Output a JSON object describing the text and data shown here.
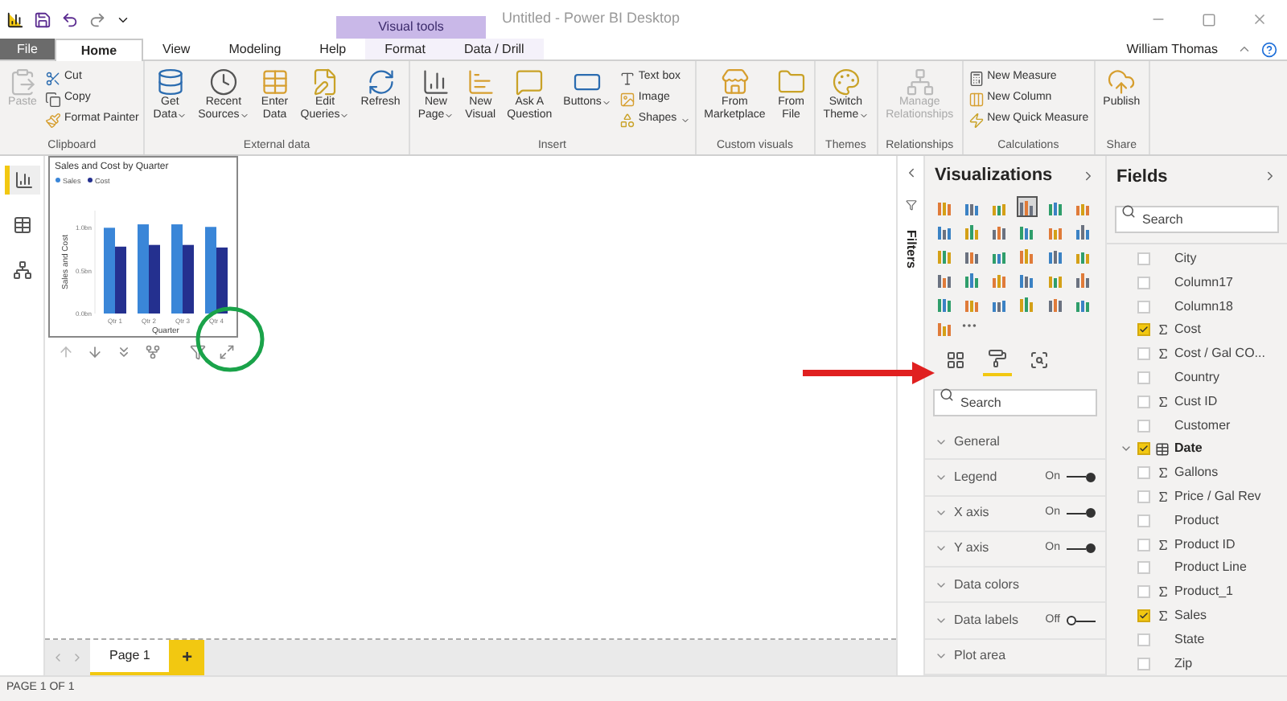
{
  "window": {
    "title": "Untitled - Power BI Desktop",
    "contextual_group": "Visual tools"
  },
  "tabs": [
    {
      "label": "File",
      "kind": "file",
      "selected": false
    },
    {
      "label": "Home",
      "kind": "normal",
      "selected": true
    },
    {
      "label": "View",
      "kind": "normal",
      "selected": false
    },
    {
      "label": "Modeling",
      "kind": "normal",
      "selected": false
    },
    {
      "label": "Help",
      "kind": "normal",
      "selected": false
    },
    {
      "label": "Format",
      "kind": "contextual",
      "selected": false
    },
    {
      "label": "Data / Drill",
      "kind": "contextual",
      "selected": false
    }
  ],
  "user": "William Thomas",
  "ribbon": [
    {
      "label": "Clipboard",
      "items": [
        {
          "kind": "large",
          "lines": [
            "Paste"
          ],
          "disabled": true,
          "dropdown": false
        },
        {
          "kind": "small",
          "lines": [
            "Cut"
          ],
          "disabled": false,
          "dropdown": false
        },
        {
          "kind": "small",
          "lines": [
            "Copy"
          ],
          "disabled": false,
          "dropdown": false
        },
        {
          "kind": "small",
          "lines": [
            "Format Painter"
          ],
          "disabled": false,
          "dropdown": false
        }
      ]
    },
    {
      "label": "External data",
      "items": [
        {
          "kind": "large",
          "lines": [
            "Get",
            "Data"
          ],
          "disabled": false,
          "dropdown": true
        },
        {
          "kind": "large",
          "lines": [
            "Recent",
            "Sources"
          ],
          "disabled": false,
          "dropdown": true
        },
        {
          "kind": "large",
          "lines": [
            "Enter",
            "Data"
          ],
          "disabled": false,
          "dropdown": false
        },
        {
          "kind": "large",
          "lines": [
            "Edit",
            "Queries"
          ],
          "disabled": false,
          "dropdown": true
        },
        {
          "kind": "large",
          "lines": [
            "Refresh"
          ],
          "disabled": false,
          "dropdown": false
        }
      ]
    },
    {
      "label": "Insert",
      "items": [
        {
          "kind": "large",
          "lines": [
            "New",
            "Page"
          ],
          "disabled": false,
          "dropdown": true
        },
        {
          "kind": "large",
          "lines": [
            "New",
            "Visual"
          ],
          "disabled": false,
          "dropdown": false
        },
        {
          "kind": "large",
          "lines": [
            "Ask A",
            "Question"
          ],
          "disabled": false,
          "dropdown": false
        },
        {
          "kind": "large",
          "lines": [
            "Buttons"
          ],
          "disabled": false,
          "dropdown": true
        },
        {
          "kind": "small",
          "lines": [
            "Text box"
          ],
          "disabled": false,
          "dropdown": false
        },
        {
          "kind": "small",
          "lines": [
            "Image"
          ],
          "disabled": false,
          "dropdown": false
        },
        {
          "kind": "small",
          "lines": [
            "Shapes"
          ],
          "disabled": false,
          "dropdown": true
        }
      ]
    },
    {
      "label": "Custom visuals",
      "items": [
        {
          "kind": "large",
          "lines": [
            "From",
            "Marketplace"
          ],
          "disabled": false,
          "dropdown": false
        },
        {
          "kind": "large",
          "lines": [
            "From",
            "File"
          ],
          "disabled": false,
          "dropdown": false
        }
      ]
    },
    {
      "label": "Themes",
      "items": [
        {
          "kind": "large",
          "lines": [
            "Switch",
            "Theme"
          ],
          "disabled": false,
          "dropdown": true
        }
      ]
    },
    {
      "label": "Relationships",
      "items": [
        {
          "kind": "large",
          "lines": [
            "Manage",
            "Relationships"
          ],
          "disabled": true,
          "dropdown": false
        }
      ]
    },
    {
      "label": "Calculations",
      "items": [
        {
          "kind": "small",
          "lines": [
            "New Measure"
          ],
          "disabled": false,
          "dropdown": false
        },
        {
          "kind": "small",
          "lines": [
            "New Column"
          ],
          "disabled": false,
          "dropdown": false
        },
        {
          "kind": "small",
          "lines": [
            "New Quick Measure"
          ],
          "disabled": false,
          "dropdown": false
        }
      ]
    },
    {
      "label": "Share",
      "items": [
        {
          "kind": "large",
          "lines": [
            "Publish"
          ],
          "disabled": false,
          "dropdown": false
        }
      ]
    }
  ],
  "views": [
    {
      "selected": true
    },
    {
      "selected": false
    },
    {
      "selected": false
    }
  ],
  "visual": {
    "chart_data": {
      "type": "bar",
      "title": "Sales and Cost by Quarter",
      "xlabel": "Quarter",
      "ylabel": "Sales and Cost",
      "categories": [
        "Qtr 1",
        "Qtr 2",
        "Qtr 3",
        "Qtr 4"
      ],
      "series": [
        {
          "name": "Sales",
          "color": "#3a86d8",
          "values": [
            1.0,
            1.04,
            1.04,
            1.01
          ]
        },
        {
          "name": "Cost",
          "color": "#24308f",
          "values": [
            0.78,
            0.8,
            0.8,
            0.77
          ]
        }
      ],
      "legend": "top",
      "ylim": [
        0,
        1.2
      ],
      "yticks": [
        {
          "value": 0,
          "label": "0.0bn"
        },
        {
          "value": 0.5,
          "label": "0.5bn"
        },
        {
          "value": 1,
          "label": "1.0bn"
        }
      ]
    }
  },
  "pages": [
    {
      "label": "Page 1",
      "selected": true
    }
  ],
  "add_page": "+",
  "filters": {
    "label": "Filters"
  },
  "visualizations": {
    "title": "Visualizations",
    "visual_types": [
      {
        "selected": false
      },
      {
        "selected": false
      },
      {
        "selected": false
      },
      {
        "selected": true
      },
      {
        "selected": false
      },
      {
        "selected": false
      },
      {
        "selected": false
      },
      {
        "selected": false
      },
      {
        "selected": false
      },
      {
        "selected": false
      },
      {
        "selected": false
      },
      {
        "selected": false
      },
      {
        "selected": false
      },
      {
        "selected": false
      },
      {
        "selected": false
      },
      {
        "selected": false
      },
      {
        "selected": false
      },
      {
        "selected": false
      },
      {
        "selected": false
      },
      {
        "selected": false
      },
      {
        "selected": false
      },
      {
        "selected": false
      },
      {
        "selected": false
      },
      {
        "selected": false
      },
      {
        "selected": false
      },
      {
        "selected": false
      },
      {
        "selected": false
      },
      {
        "selected": false
      },
      {
        "selected": false
      },
      {
        "selected": false
      },
      {
        "selected": false
      }
    ],
    "pane_tabs": [
      {
        "selected": false
      },
      {
        "selected": true
      },
      {
        "selected": false
      }
    ],
    "search": {
      "placeholder": "Search"
    },
    "sections": [
      {
        "label": "General"
      },
      {
        "label": "Legend",
        "toggle": {
          "label": "On",
          "on": true
        }
      },
      {
        "label": "X axis",
        "toggle": {
          "label": "On",
          "on": true
        }
      },
      {
        "label": "Y axis",
        "toggle": {
          "label": "On",
          "on": true
        }
      },
      {
        "label": "Data colors"
      },
      {
        "label": "Data labels",
        "toggle": {
          "label": "Off",
          "on": false
        }
      },
      {
        "label": "Plot area"
      }
    ]
  },
  "fields": {
    "title": "Fields",
    "search": {
      "placeholder": "Search"
    },
    "items": [
      {
        "label": "City",
        "kind": "plain",
        "checked": false
      },
      {
        "label": "Column17",
        "kind": "plain",
        "checked": false
      },
      {
        "label": "Column18",
        "kind": "plain",
        "checked": false
      },
      {
        "label": "Cost",
        "kind": "sum",
        "checked": true
      },
      {
        "label": "Cost / Gal CO...",
        "kind": "sum",
        "checked": false
      },
      {
        "label": "Country",
        "kind": "plain",
        "checked": false
      },
      {
        "label": "Cust ID",
        "kind": "sum",
        "checked": false
      },
      {
        "label": "Customer",
        "kind": "plain",
        "checked": false
      },
      {
        "label": "Date",
        "kind": "table",
        "checked": true,
        "expanded": true
      },
      {
        "label": "Gallons",
        "kind": "sum",
        "checked": false
      },
      {
        "label": "Price / Gal Rev",
        "kind": "sum",
        "checked": false
      },
      {
        "label": "Product",
        "kind": "plain",
        "checked": false
      },
      {
        "label": "Product ID",
        "kind": "sum",
        "checked": false
      },
      {
        "label": "Product Line",
        "kind": "plain",
        "checked": false
      },
      {
        "label": "Product_1",
        "kind": "sum",
        "checked": false
      },
      {
        "label": "Sales",
        "kind": "sum",
        "checked": true
      },
      {
        "label": "State",
        "kind": "plain",
        "checked": false
      },
      {
        "label": "Zip",
        "kind": "plain",
        "checked": false
      }
    ]
  },
  "status_bar": "PAGE 1 OF 1"
}
